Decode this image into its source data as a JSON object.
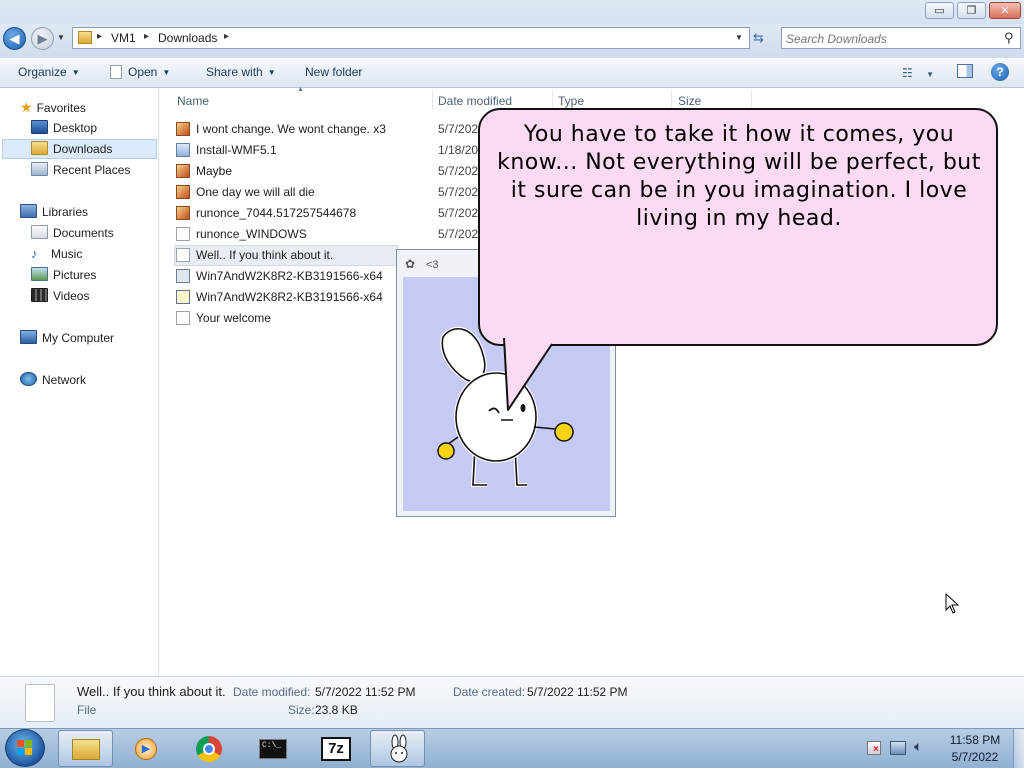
{
  "window": {
    "minimize_glyph": "▭",
    "maximize_glyph": "❐",
    "close_glyph": "✕"
  },
  "address": {
    "crumbs": [
      "VM1",
      "Downloads"
    ],
    "separator": "▸",
    "search_placeholder": "Search Downloads"
  },
  "toolbar": {
    "organize": "Organize",
    "open": "Open",
    "share_with": "Share with",
    "new_folder": "New folder"
  },
  "nav": {
    "favorites": "Favorites",
    "desktop": "Desktop",
    "downloads": "Downloads",
    "recent_places": "Recent Places",
    "libraries": "Libraries",
    "documents": "Documents",
    "music": "Music",
    "pictures": "Pictures",
    "videos": "Videos",
    "my_computer": "My Computer",
    "network": "Network"
  },
  "columns": {
    "name": "Name",
    "date_modified": "Date modified",
    "type": "Type",
    "size": "Size"
  },
  "files": [
    {
      "name": "I wont change. We wont change. x3",
      "date": "5/7/2022",
      "icon": "image-file-icon"
    },
    {
      "name": "Install-WMF5.1",
      "date": "1/18/20",
      "icon": "powershell-file-icon"
    },
    {
      "name": "Maybe",
      "date": "5/7/202",
      "icon": "image-file-icon"
    },
    {
      "name": "One day we will all die",
      "date": "5/7/202",
      "icon": "image-file-icon"
    },
    {
      "name": "runonce_7044.517257544678",
      "date": "5/7/202",
      "icon": "image-file-icon"
    },
    {
      "name": "runonce_WINDOWS",
      "date": "5/7/202",
      "icon": "text-file-icon"
    },
    {
      "name": "Well.. If you think about it.",
      "date": "",
      "icon": "text-file-icon"
    },
    {
      "name": "Win7AndW2K8R2-KB3191566-x64",
      "date": "",
      "icon": "installer-file-icon"
    },
    {
      "name": "Win7AndW2K8R2-KB3191566-x64",
      "date": "",
      "icon": "update-package-icon"
    },
    {
      "name": "Your welcome",
      "date": "",
      "icon": "text-file-icon"
    }
  ],
  "pet_window": {
    "title": "<3"
  },
  "bubble": {
    "text": "You have to take it how it comes, you know... Not everything will be perfect, but it sure can be in you imagination. I love living in my head."
  },
  "details": {
    "filename": "Well.. If you think about it.",
    "filetype": "File",
    "date_modified_label": "Date modified:",
    "date_modified": "5/7/2022 11:52 PM",
    "date_created_label": "Date created:",
    "date_created": "5/7/2022 11:52 PM",
    "size_label": "Size:",
    "size": "23.8 KB"
  },
  "clock": {
    "time": "11:58 PM",
    "date": "5/7/2022"
  },
  "taskbar": {
    "sevenzip_label": "7z"
  }
}
